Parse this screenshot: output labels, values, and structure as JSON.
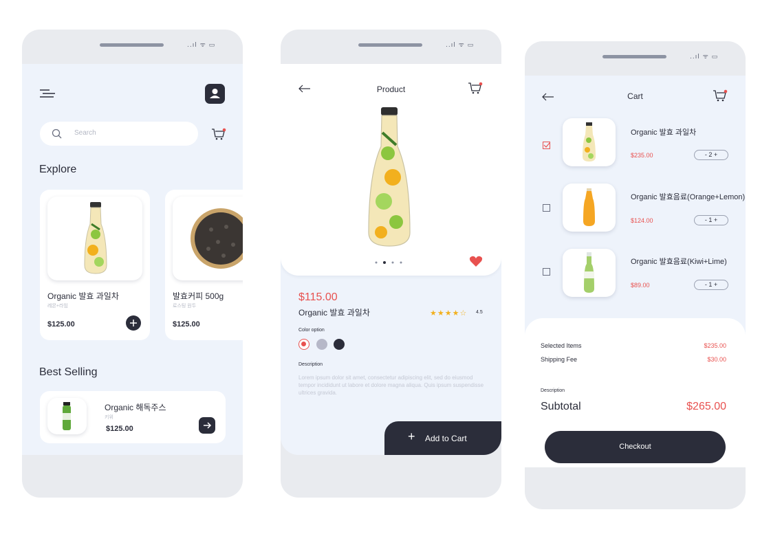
{
  "colors": {
    "accent": "#e8514f",
    "dark": "#2b2d3a",
    "bg": "#eef3fb",
    "star": "#f2b01e"
  },
  "status": {
    "signal": "..ıl ᯤ ▭"
  },
  "home": {
    "search_placeholder": "Search",
    "explore_title": "Explore",
    "products": [
      {
        "name": "Organic 발효 과일차",
        "sub": "레몬+라임",
        "price": "$125.00"
      },
      {
        "name": "발효커피 500g",
        "sub": "로스팅 원두",
        "price": "$125.00"
      }
    ],
    "best_title": "Best Selling",
    "best": {
      "name": "Organic 해독주스",
      "sub": "키위",
      "price": "$125.00"
    }
  },
  "product": {
    "title": "Product",
    "price": "$115.00",
    "name": "Organic 발효 과일차",
    "stars": "★★★★☆",
    "rating": "4.5",
    "color_label": "Color option",
    "desc_label": "Description",
    "desc_text": "Lorem ipsum dolor sit amet, consectetur adipiscing elit, sed do eiusmod tempor incididunt ut labore et dolore magna aliqua. Quis ipsum suspendisse ultrices gravida.",
    "add_to_cart": "Add to Cart",
    "add_icon": "+"
  },
  "cart": {
    "title": "Cart",
    "items": [
      {
        "name": "Organic 발효 과일차",
        "price": "$235.00",
        "qty": "- 2 +",
        "checked": true
      },
      {
        "name": "Organic 발효음료(Orange+Lemon)",
        "price": "$124.00",
        "qty": "- 1 +",
        "checked": false
      },
      {
        "name": "Organic 발효음료(Kiwi+Lime)",
        "price": "$89.00",
        "qty": "- 1 +",
        "checked": false
      }
    ],
    "selected_label": "Selected Items",
    "selected_value": "$235.00",
    "shipping_label": "Shipping Fee",
    "shipping_value": "$30.00",
    "desc_label": "Description",
    "subtotal_label": "Subtotal",
    "subtotal_value": "$265.00",
    "checkout": "Checkout"
  }
}
